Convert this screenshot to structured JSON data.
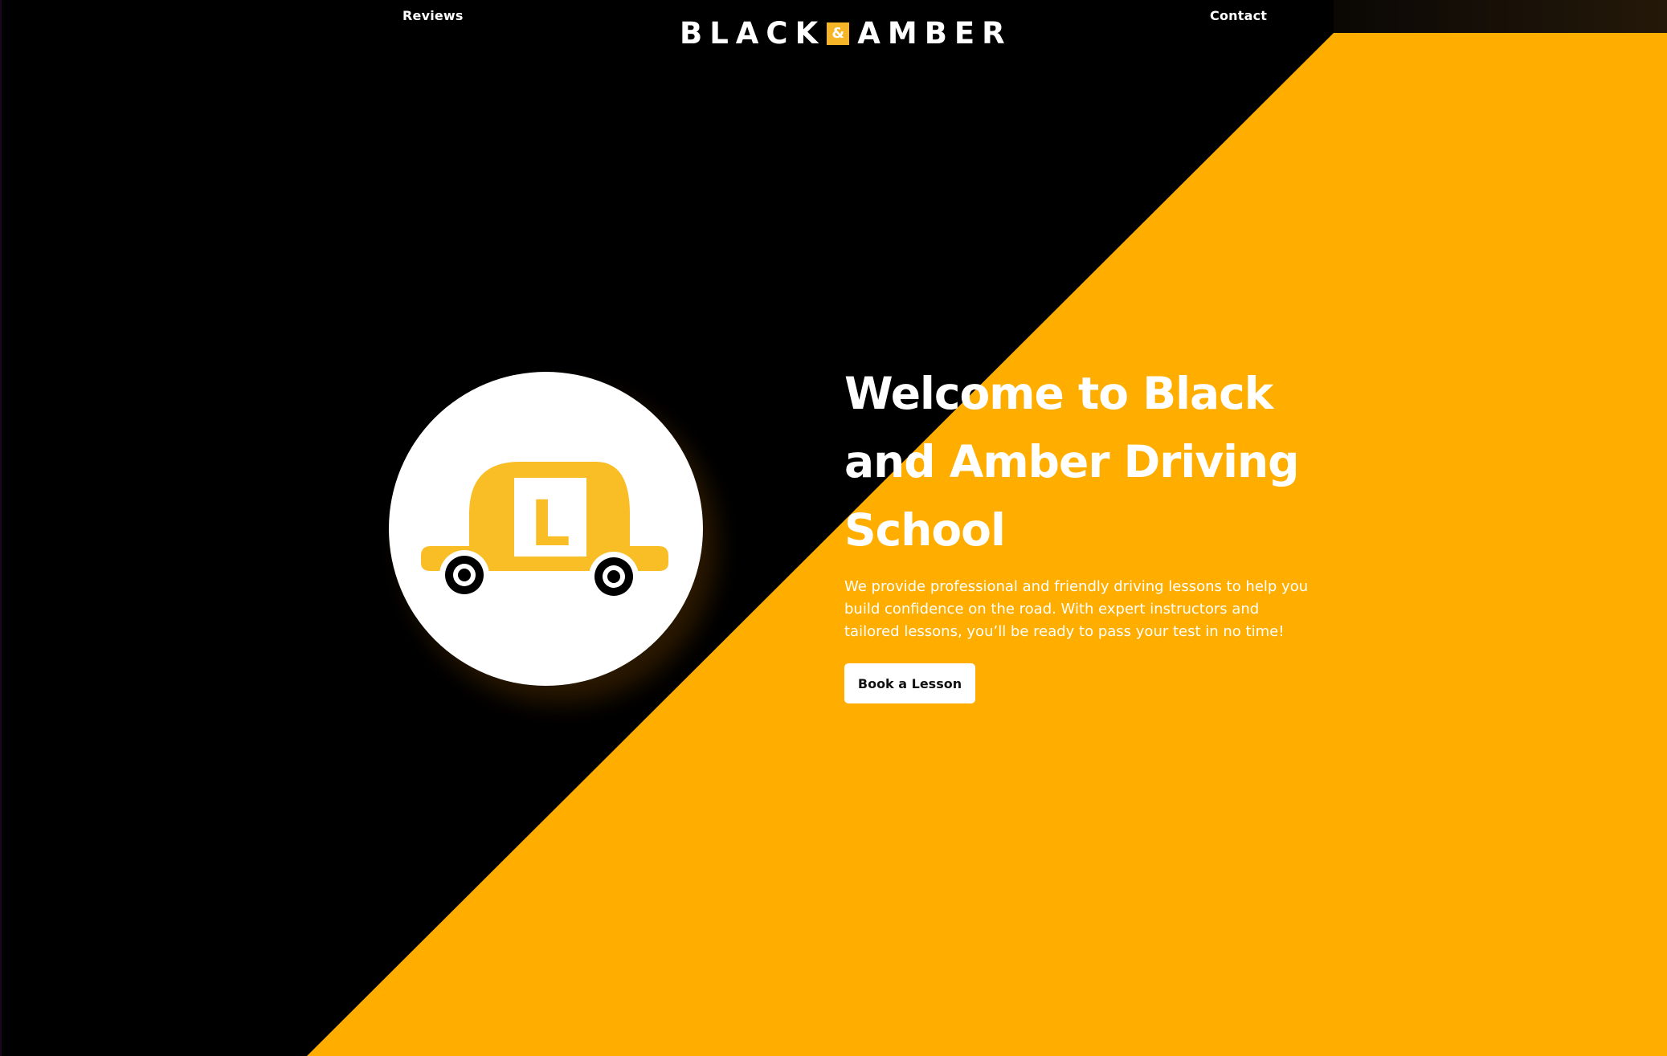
{
  "nav": {
    "reviews": "Reviews",
    "contact": "Contact"
  },
  "logo": {
    "word1": "BLACK",
    "amp": "&",
    "word2": "AMBER"
  },
  "hero": {
    "title": "Welcome to Black and Amber Driving School",
    "text": "We provide professional and friendly driving lessons to help you build confidence on the road. With expert instructors and tailored lessons, you’ll be ready to pass your test in no time!",
    "cta": "Book a Lesson",
    "car_plate": "L",
    "icons": [
      "learner-car-icon"
    ]
  },
  "colors": {
    "black": "#000000",
    "amber": "#ffae00",
    "car": "#f9bd26",
    "white": "#ffffff"
  }
}
